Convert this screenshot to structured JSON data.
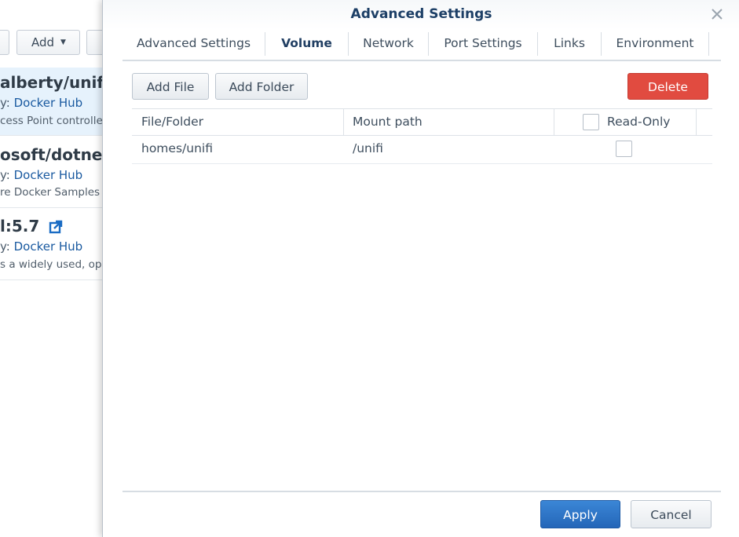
{
  "background": {
    "toolbar": {
      "add_label": "Add"
    },
    "items": [
      {
        "title": "alberty/unifi",
        "source_prefix": "y: ",
        "source": "Docker Hub",
        "description": "cess Point controller"
      },
      {
        "title": "osoft/dotnet-",
        "source_prefix": "y: ",
        "source": "Docker Hub",
        "description": "re Docker Samples"
      },
      {
        "title": "l:5.7",
        "source_prefix": "y: ",
        "source": "Docker Hub",
        "description": "s a widely used, op"
      }
    ]
  },
  "dialog": {
    "title": "Advanced Settings",
    "tabs": [
      {
        "label": "Advanced Settings"
      },
      {
        "label": "Volume"
      },
      {
        "label": "Network"
      },
      {
        "label": "Port Settings"
      },
      {
        "label": "Links"
      },
      {
        "label": "Environment"
      }
    ],
    "active_tab": "Volume",
    "toolbar": {
      "add_file": "Add File",
      "add_folder": "Add Folder",
      "delete": "Delete"
    },
    "table": {
      "columns": {
        "file_folder": "File/Folder",
        "mount_path": "Mount path",
        "read_only": "Read-Only"
      },
      "rows": [
        {
          "file_folder": "homes/unifi",
          "mount_path": "/unifi",
          "read_only": false
        }
      ]
    },
    "footer": {
      "apply": "Apply",
      "cancel": "Cancel"
    }
  },
  "colors": {
    "accent_blue": "#2466b8",
    "danger_red": "#e14b40",
    "title_blue": "#1d3f66",
    "link_blue": "#1a5aa0"
  },
  "icons": {
    "close": "close-icon",
    "caret": "caret-down-icon",
    "external_link": "external-link-icon"
  }
}
